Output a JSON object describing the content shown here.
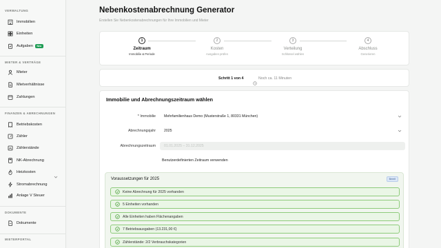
{
  "sidebar": {
    "sections": [
      {
        "title": "VERWALTUNG",
        "items": [
          {
            "label": "Immobilien",
            "icon": "building-icon"
          },
          {
            "label": "Einheiten",
            "icon": "grid-icon"
          },
          {
            "label": "Aufgaben",
            "icon": "clipboard-icon",
            "badge": "Neu"
          }
        ]
      },
      {
        "title": "MIETER & VERTRÄGE",
        "items": [
          {
            "label": "Mieter",
            "icon": "user-icon"
          },
          {
            "label": "Mietverhältnisse",
            "icon": "document-icon"
          },
          {
            "label": "Zahlungen",
            "icon": "calendar-icon"
          }
        ]
      },
      {
        "title": "FINANZEN & ABRECHNUNGEN",
        "items": [
          {
            "label": "Betriebskosten",
            "icon": "receipt-icon"
          },
          {
            "label": "Zähler",
            "icon": "gauge-icon"
          },
          {
            "label": "Zählerstände",
            "icon": "counter-icon"
          },
          {
            "label": "NK-Abrechnung",
            "icon": "calculator-icon"
          },
          {
            "label": "Heizkosten",
            "icon": "flame-icon",
            "expandable": true
          },
          {
            "label": "Stromabrechnung",
            "icon": "bolt-icon"
          },
          {
            "label": "Anlage V Steuer",
            "icon": "chart-icon"
          }
        ]
      },
      {
        "title": "DOKUMENTE",
        "items": [
          {
            "label": "Dokumente",
            "icon": "folder-icon"
          }
        ]
      },
      {
        "title": "MIETERPORTAL",
        "items": []
      }
    ]
  },
  "header": {
    "title": "Nebenkostenabrechnung Generator",
    "subtitle": "Erstellen Sie Nebenkostenabrechnungen für Ihre Immobilien und Mieter"
  },
  "steps": [
    {
      "num": "1",
      "name": "Zeitraum",
      "desc": "Immobilie & Periode",
      "active": true
    },
    {
      "num": "2",
      "name": "Kosten",
      "desc": "Ausgaben prüfen",
      "active": false
    },
    {
      "num": "3",
      "name": "Verteilung",
      "desc": "Schlüssel wählen",
      "active": false
    },
    {
      "num": "4",
      "name": "Abschluss",
      "desc": "Generieren",
      "active": false
    }
  ],
  "progress": {
    "step_text": "Schritt 1 von 4",
    "eta_text": "Noch ca. 11 Minuten"
  },
  "form": {
    "title": "Immobilie und Abrechnungszeitraum wählen",
    "property_label": "* Immobilie",
    "property_value": "Mehrfamilienhaus Demo (Musterstraße 1, 80331 München)",
    "year_label": "Abrechnungsjahr",
    "year_value": "2025",
    "period_label": "Abrechnungszeitraum",
    "period_value": "01.01.2025 – 31.12.2025",
    "custom_link": "Benutzerdefinierten Zeitraum verwenden"
  },
  "requirements": {
    "title": "Voraussetzungen für 2025",
    "badge": "Bereit",
    "items": [
      "Keine Abrechnung für 2025 vorhanden",
      "5 Einheiten vorhanden",
      "Alle Einheiten haben Flächenangaben",
      "7 Betriebsausgaben (13.231,00 €)",
      "Zählerstände: 2/2 Verbrauchskategorien"
    ]
  },
  "colors": {
    "accent_green": "#1f9d55",
    "check_green": "#4a9e3a",
    "row_border": "#8dcb7a"
  }
}
